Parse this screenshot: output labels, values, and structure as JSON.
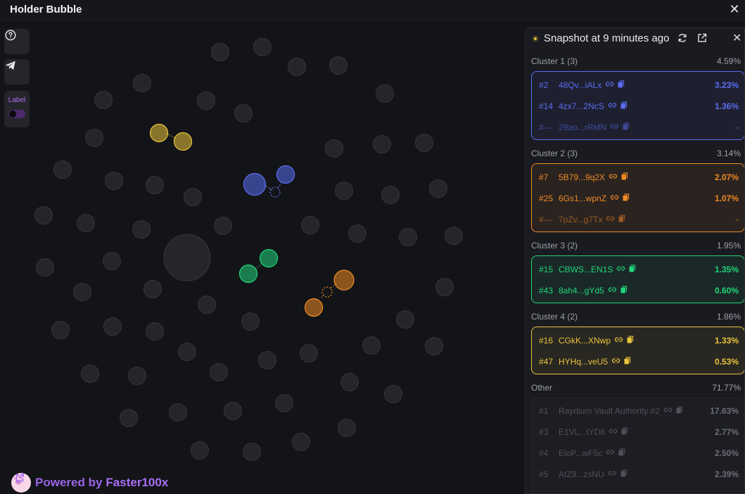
{
  "window": {
    "title": "Holder Bubble"
  },
  "toolbar": {
    "label_toggle": "Label"
  },
  "footer": {
    "powered_prefix": "Powered by",
    "brand": "Faster100x"
  },
  "panel": {
    "snapshot": "Snapshot at 9 minutes ago",
    "clusters": [
      {
        "name": "Cluster 1 (3)",
        "pct": "4.59%",
        "color": "#5a6cf0",
        "rows": [
          {
            "rank": "#2",
            "addr": "48Qv...iALx",
            "val": "3.23%"
          },
          {
            "rank": "#14",
            "addr": "4zx7...2NcS",
            "val": "1.36%"
          },
          {
            "rank": "#---",
            "addr": "29ao...rRMN",
            "val": "-"
          }
        ]
      },
      {
        "name": "Cluster 2 (3)",
        "pct": "3.14%",
        "color": "#f08a24",
        "rows": [
          {
            "rank": "#7",
            "addr": "5B79...9q2X",
            "val": "2.07%"
          },
          {
            "rank": "#25",
            "addr": "6Gs1...wpnZ",
            "val": "1.07%"
          },
          {
            "rank": "#---",
            "addr": "7pZv...g7Tx",
            "val": "-"
          }
        ]
      },
      {
        "name": "Cluster 3 (2)",
        "pct": "1.95%",
        "color": "#22d47a",
        "rows": [
          {
            "rank": "#15",
            "addr": "CBWS...EN1S",
            "val": "1.35%"
          },
          {
            "rank": "#43",
            "addr": "8ah4...gYd5",
            "val": "0.60%"
          }
        ]
      },
      {
        "name": "Cluster 4 (2)",
        "pct": "1.86%",
        "color": "#e9c43c",
        "rows": [
          {
            "rank": "#16",
            "addr": "CGkK...XNwp",
            "val": "1.33%"
          },
          {
            "rank": "#47",
            "addr": "HYHq...veU5",
            "val": "0.53%"
          }
        ]
      }
    ],
    "other": {
      "name": "Other",
      "pct": "71.77%",
      "rows": [
        {
          "rank": "#1",
          "addr": "Raydium Vault Authority #2",
          "val": "17.63%"
        },
        {
          "rank": "#3",
          "addr": "E1VL...tYD6",
          "val": "2.77%"
        },
        {
          "rank": "#4",
          "addr": "EioP...wF5c",
          "val": "2.50%"
        },
        {
          "rank": "#5",
          "addr": "AtZ9...zsNU",
          "val": "2.39%"
        }
      ]
    }
  }
}
